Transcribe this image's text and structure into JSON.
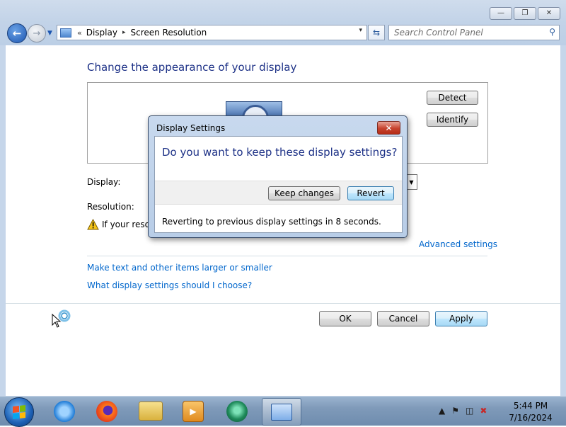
{
  "window": {
    "caption_buttons": {
      "minimize_icon": "minimize-icon",
      "maximize_icon": "maximize-icon",
      "close_icon": "close-icon"
    },
    "address_bar": {
      "root_chevron": "«",
      "crumbs": [
        "Display",
        "Screen Resolution"
      ],
      "separator": "▸",
      "dropdown": "▾"
    },
    "search": {
      "placeholder": "Search Control Panel"
    }
  },
  "main": {
    "heading": "Change the appearance of your display",
    "detect_label": "Detect",
    "identify_label": "Identify",
    "display_label": "Display:",
    "resolution_label": "Resolution:",
    "warning_text": "If your resolu",
    "advanced_link": "Advanced settings",
    "link_text_size": "Make text and other items larger or smaller",
    "link_help": "What display settings should I choose?",
    "ok_label": "OK",
    "cancel_label": "Cancel",
    "apply_label": "Apply"
  },
  "dialog": {
    "title": "Display Settings",
    "close_glyph": "✕",
    "question": "Do you want to keep these display settings?",
    "keep_label": "Keep changes",
    "revert_label": "Revert",
    "footer": "Reverting to previous display settings in 8 seconds."
  },
  "taskbar": {
    "apps": [
      "internet-explorer-icon",
      "firefox-icon",
      "file-explorer-icon",
      "media-player-icon",
      "app-icon",
      "display-settings-icon"
    ],
    "clock_time": "5:44 PM",
    "clock_date": "7/16/2024"
  },
  "colors": {
    "heading": "#1e3287",
    "link": "#0066cc",
    "taskbar": "#7f9ab9"
  }
}
